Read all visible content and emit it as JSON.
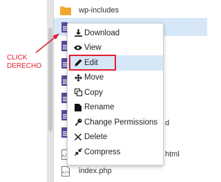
{
  "annotation": {
    "label": "CLICK DERECHO",
    "color": "#e31c2e"
  },
  "files": [
    {
      "name": "wp-includes",
      "type": "folder",
      "selected": false
    },
    {
      "name": "",
      "type": "doc",
      "selected": true
    },
    {
      "name": "",
      "type": "doc",
      "selected": false
    },
    {
      "name": "",
      "type": "doc",
      "selected": false
    },
    {
      "name": "",
      "type": "doc",
      "selected": false
    },
    {
      "name": "",
      "type": "doc",
      "selected": false
    },
    {
      "name": "",
      "type": "doc",
      "selected": false
    },
    {
      "name": "",
      "type": "doc",
      "selected": false
    },
    {
      "name": "",
      "type": "code",
      "selected": false,
      "trailing": "html"
    },
    {
      "name": "index.php",
      "type": "code",
      "selected": false
    }
  ],
  "row_fragments": {
    "tail_d": "d",
    "tail_html": "html"
  },
  "context_menu": {
    "items": [
      {
        "label": "Download",
        "icon": "download-icon"
      },
      {
        "label": "View",
        "icon": "eye-icon"
      },
      {
        "label": "Edit",
        "icon": "pencil-icon",
        "active": true
      },
      {
        "label": "Move",
        "icon": "move-icon"
      },
      {
        "label": "Copy",
        "icon": "copy-icon"
      },
      {
        "label": "Rename",
        "icon": "rename-icon"
      },
      {
        "label": "Change Permissions",
        "icon": "key-icon"
      },
      {
        "label": "Delete",
        "icon": "delete-icon"
      },
      {
        "label": "Compress",
        "icon": "compress-icon"
      }
    ]
  },
  "colors": {
    "folder": "#f0a830",
    "doc": "#5b4c9c",
    "selection": "#d6e7f7",
    "highlight": "#e31c2e"
  }
}
